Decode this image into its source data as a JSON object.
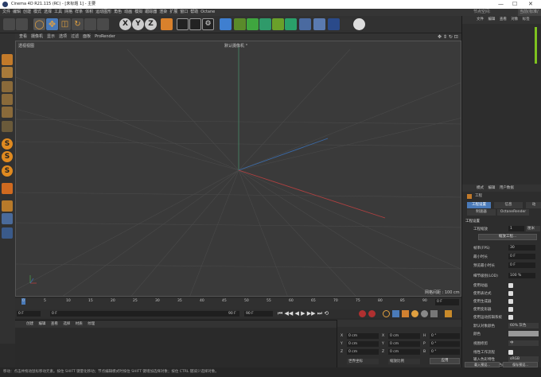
{
  "window": {
    "title": "Cinema 4D R21.115 (RC) - [未标题 1] - 主要"
  },
  "menubar": {
    "items": [
      "文件",
      "编辑",
      "创建",
      "模式",
      "选择",
      "工具",
      "网格",
      "样条",
      "体积",
      "运动图形",
      "角色",
      "动画",
      "模拟",
      "跟踪器",
      "渲染",
      "扩展",
      "窗口",
      "帮助",
      "Octane"
    ],
    "right_items": [
      "节点空间:",
      "当前(标准/物"
    ]
  },
  "viewport": {
    "menu": [
      "查看",
      "摄像机",
      "显示",
      "选项",
      "过滤",
      "面板",
      "ProRender"
    ],
    "label": "透视视图",
    "camera": "默认摄像机 °",
    "grid_spacing": "网格间距 : 100 cm"
  },
  "timeline": {
    "ticks": [
      "0",
      "5",
      "10",
      "15",
      "20",
      "25",
      "30",
      "35",
      "40",
      "45",
      "50",
      "55",
      "60",
      "65",
      "70",
      "75",
      "80",
      "85",
      "90"
    ],
    "end_frame": "0 F"
  },
  "transport": {
    "current": "0 F",
    "start": "0 F",
    "end_a": "90 F",
    "end_b": "90 F"
  },
  "material_manager": {
    "menu": [
      "创建",
      "编辑",
      "查看",
      "选择",
      "材质",
      "纹理"
    ]
  },
  "coordinate_manager": {
    "rows": [
      {
        "a": "X",
        "av": "0 cm",
        "b": "X",
        "bv": "0 cm",
        "c": "H",
        "cv": "0 °"
      },
      {
        "a": "Y",
        "av": "0 cm",
        "b": "Y",
        "bv": "0 cm",
        "c": "P",
        "cv": "0 °"
      },
      {
        "a": "Z",
        "av": "0 cm",
        "b": "Z",
        "bv": "0 cm",
        "c": "B",
        "cv": "0 °"
      }
    ],
    "dropdown_a": "世界坐标",
    "dropdown_b": "缩放比例",
    "apply": "应用"
  },
  "object_manager": {
    "menu": [
      "文件",
      "编辑",
      "查看",
      "对象",
      "标签"
    ]
  },
  "attribute_manager": {
    "menu": [
      "模式",
      "编辑",
      "用户数据"
    ],
    "title": "工程",
    "tabs_row1": [
      "工程设置",
      "信息",
      "动"
    ],
    "tabs_row2": [
      "制速器",
      "OctaneRender"
    ],
    "section": "工程设置",
    "scale_label": "工程缩放",
    "scale_value": "1",
    "scale_unit": "厘米",
    "scale_button": "缩放工程...",
    "fields": [
      {
        "label": "帧率(FPS)",
        "value": "30"
      },
      {
        "label": "最小时长",
        "value": "0 F"
      },
      {
        "label": "预览最小时长",
        "value": "0 F"
      },
      {
        "label": "细节级别(LOD)",
        "value": "100 %"
      }
    ],
    "checks": [
      "使用动画",
      "使用表达式",
      "使用生成器",
      "使用变形器",
      "使用运动剪辑系统"
    ],
    "default_color_label": "默认对象颜色",
    "default_color_value": "60% 灰色",
    "color_label": "颜色",
    "clip_label": "视图修剪",
    "clip_value": "中",
    "linear_label": "线性工作流程",
    "input_color_label": "输入色彩特性",
    "input_color_value": "sRGB",
    "node_label": "为节点材质使用颜色通道",
    "load_button": "载入预设...",
    "save_button": "保存预设..."
  },
  "status": {
    "text": "移动：点击并拖动鼠标移动元素。按住 SHIFT 键量化移动；节点编辑模式时按住 SHIFT 键增加选择对象；按住 CTRL 键减少选择对象。"
  },
  "colors": {
    "accent_blue": "#4a7ab8",
    "green_bar": "#7ec21f"
  }
}
